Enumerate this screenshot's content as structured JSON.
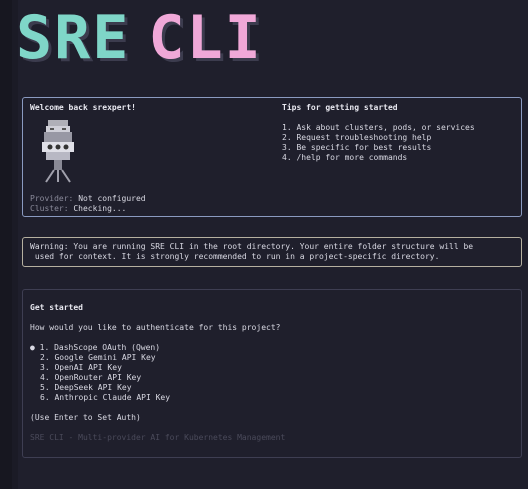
{
  "logo": {
    "part1": "SRE",
    "part2": "CLI"
  },
  "welcome": {
    "greeting": "Welcome back srexpert!",
    "provider_label": "Provider:",
    "provider_value": "Not configured",
    "cluster_label": "Cluster:",
    "cluster_value": "Checking..."
  },
  "tips": {
    "title": "Tips for getting started",
    "items": [
      "1. Ask about clusters, pods, or services",
      "2. Request troubleshooting help",
      "3. Be specific for best results",
      "4. /help for more commands"
    ]
  },
  "warning": {
    "line1": "Warning: You are running SRE CLI in the root directory. Your entire folder structure will be",
    "line2": " used for context. It is strongly recommended to run in a project-specific directory."
  },
  "auth": {
    "title": "Get started",
    "question": "How would you like to authenticate for this project?",
    "selected_marker": "●",
    "options": [
      "1. DashScope OAuth (Qwen)",
      "2. Google Gemini API Key",
      "3. OpenAI API Key",
      "4. OpenRouter API Key",
      "5. DeepSeek API Key",
      "6. Anthropic Claude API Key"
    ],
    "hint": "(Use Enter to Set Auth)",
    "footer": "SRE CLI - Multi-provider AI for Kubernetes Management"
  },
  "colors": {
    "accent_teal": "#7fd6c8",
    "accent_pink": "#f0a8d8",
    "background": "#1f1f2c",
    "selected_option": "#e8e8f0"
  }
}
